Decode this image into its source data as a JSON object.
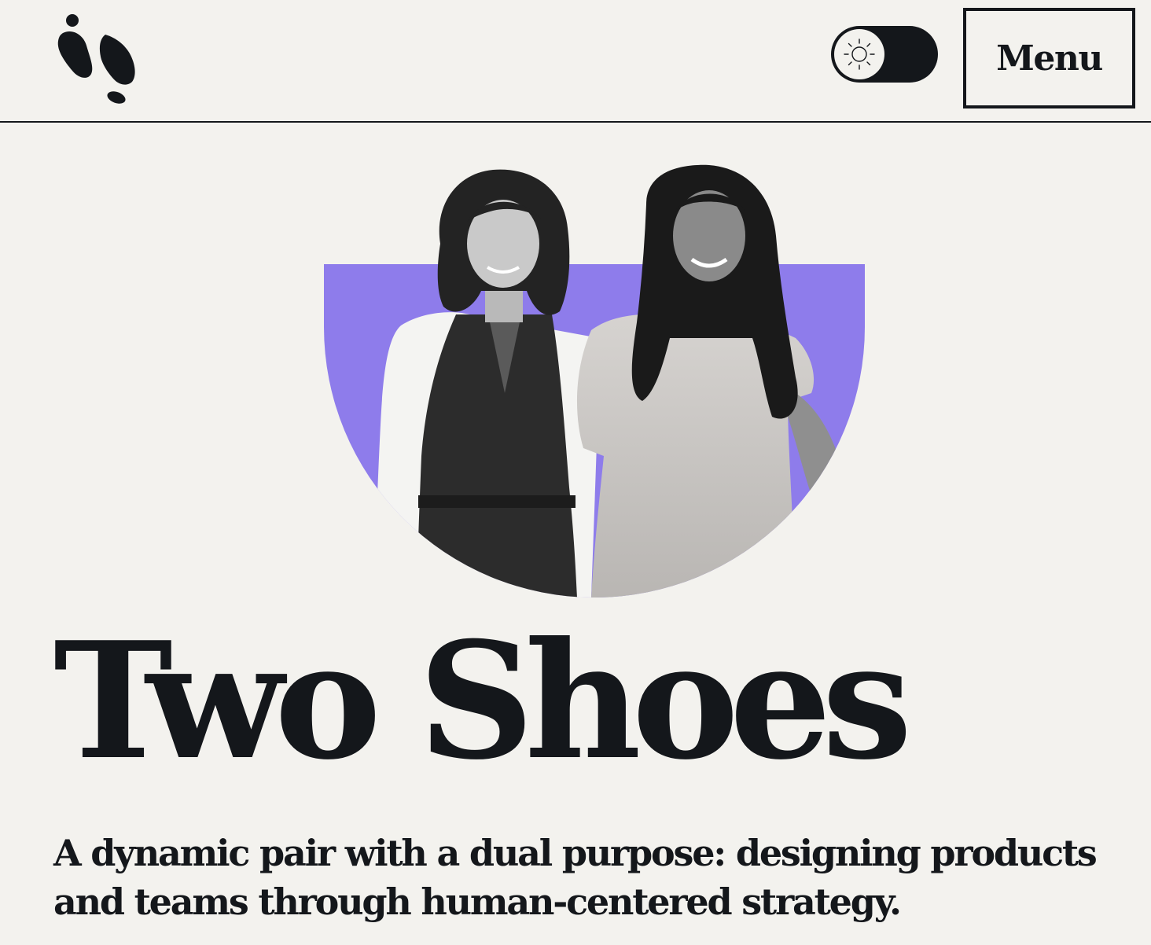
{
  "header": {
    "logo_icon": "two-footprints-logo-icon",
    "theme_toggle": {
      "icon": "sun-icon",
      "state": "light"
    },
    "menu_label": "Menu"
  },
  "hero": {
    "title": "Two Shoes",
    "subtitle": "A dynamic pair with a dual purpose: designing products and teams through human-centered strategy.",
    "photo": {
      "accent_color": "#8e7ceb"
    }
  },
  "colors": {
    "background": "#f3f2ee",
    "ink": "#14171b",
    "accent": "#8e7ceb"
  }
}
